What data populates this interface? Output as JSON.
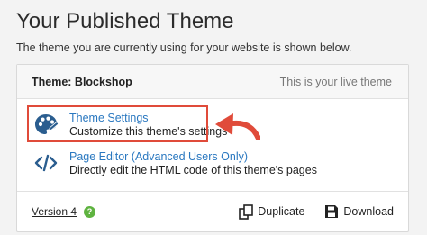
{
  "page": {
    "title": "Your Published Theme",
    "subtitle": "The theme you are currently using for your website is shown below."
  },
  "card": {
    "theme_label": "Theme: Blockshop",
    "live_label": "This is your live theme",
    "options": [
      {
        "title": "Theme Settings",
        "description": "Customize this theme's settings",
        "icon": "palette-icon"
      },
      {
        "title": "Page Editor (Advanced Users Only)",
        "description": "Directly edit the HTML code of this theme's pages",
        "icon": "code-icon"
      }
    ],
    "footer": {
      "version_label": "Version 4",
      "help_icon": "?",
      "duplicate_label": "Duplicate",
      "download_label": "Download"
    }
  },
  "colors": {
    "link": "#2a78c0",
    "highlight": "#e04b3a",
    "help": "#5fb340"
  }
}
